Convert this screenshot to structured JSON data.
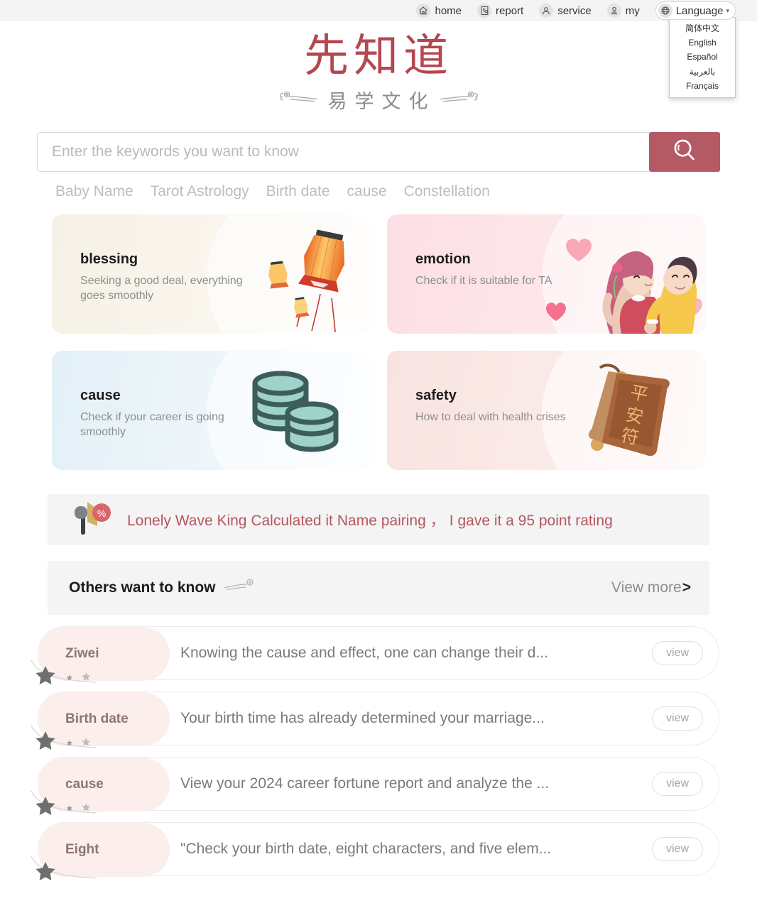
{
  "nav": {
    "items": [
      {
        "label": "home",
        "icon": "home-icon"
      },
      {
        "label": "report",
        "icon": "report-icon"
      },
      {
        "label": "service",
        "icon": "service-icon"
      },
      {
        "label": "my",
        "icon": "user-icon"
      }
    ],
    "language": {
      "label": "Language",
      "icon": "globe-icon",
      "caret": "▾",
      "open": true,
      "options": [
        "简体中文",
        "English",
        "Español",
        "بالعربية",
        "Français"
      ]
    }
  },
  "logo": {
    "main": "先知道",
    "sub": "易学文化",
    "main_color": "#b5474f",
    "sub_color": "#8c8c8c"
  },
  "search": {
    "value": "",
    "placeholder": "Enter the keywords you want to know",
    "button_icon": "search-icon",
    "button_color": "#b35a64",
    "tags": [
      "Baby Name",
      "Tarot Astrology",
      "Birth date",
      "cause",
      "Constellation"
    ]
  },
  "cards": [
    {
      "title": "blessing",
      "desc": "Seeking a good deal, everything goes smoothly",
      "art": "lanterns-illustration",
      "bg": "#f6f1e6"
    },
    {
      "title": "emotion",
      "desc": "Check if it is suitable for TA",
      "art": "couple-hearts-illustration",
      "bg": "#fcdfe4"
    },
    {
      "title": "cause",
      "desc": "Check if your career is going smoothly",
      "art": "coin-stacks-illustration",
      "bg": "#e3f0f7"
    },
    {
      "title": "safety",
      "desc": "How to deal with health crises",
      "art": "amulet-illustration",
      "bg": "#f8e3e0"
    }
  ],
  "announcement": {
    "icon": "megaphone-percent-icon",
    "segments": [
      "Lonely Wave King Calculated it",
      "Name pairing",
      "，",
      "I gave it a 95 point rating"
    ],
    "color": "#b5565e"
  },
  "others": {
    "title": "Others want to know",
    "decoration": "cloud-swirl-icon",
    "more_label": "View more",
    "more_chevron": ">"
  },
  "list": {
    "rows": [
      {
        "tag": "Ziwei",
        "desc": "Knowing the cause and effect, one can change their d...",
        "action": "view"
      },
      {
        "tag": "Birth date",
        "desc": "Your birth time has already determined your marriage...",
        "action": "view"
      },
      {
        "tag": "cause",
        "desc": "View your 2024 career fortune report and analyze the ...",
        "action": "view"
      },
      {
        "tag": "Eight",
        "desc": "\"Check your birth date, eight characters, and five elem...",
        "action": "view"
      }
    ]
  }
}
